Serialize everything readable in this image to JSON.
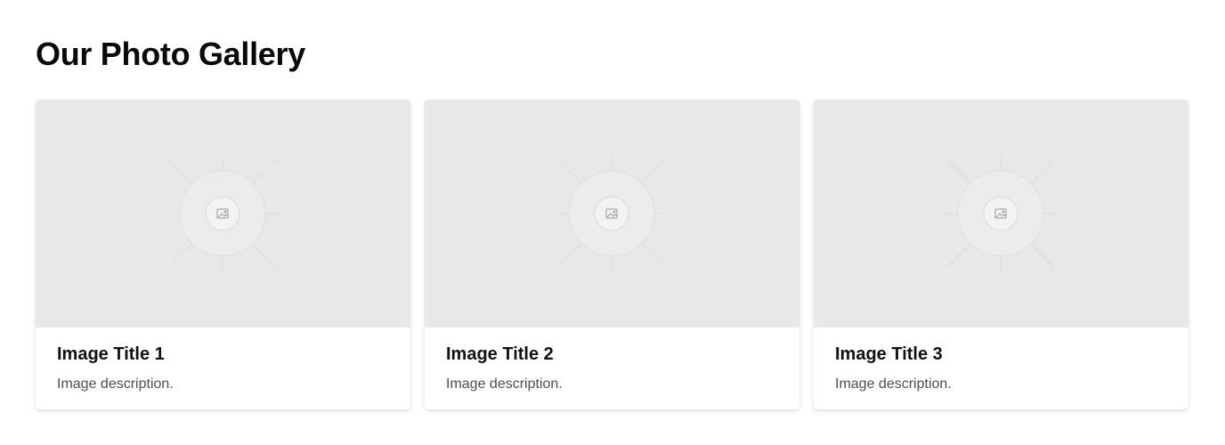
{
  "page": {
    "title": "Our Photo Gallery"
  },
  "gallery": {
    "items": [
      {
        "title": "Image Title 1",
        "description": "Image description.",
        "placeholder_icon": "image-icon"
      },
      {
        "title": "Image Title 2",
        "description": "Image description.",
        "placeholder_icon": "image-icon"
      },
      {
        "title": "Image Title 3",
        "description": "Image description.",
        "placeholder_icon": "image-icon"
      }
    ]
  },
  "colors": {
    "placeholder_bg": "#e8e8e8",
    "title_text": "#111111",
    "description_text": "#4a4f55"
  }
}
